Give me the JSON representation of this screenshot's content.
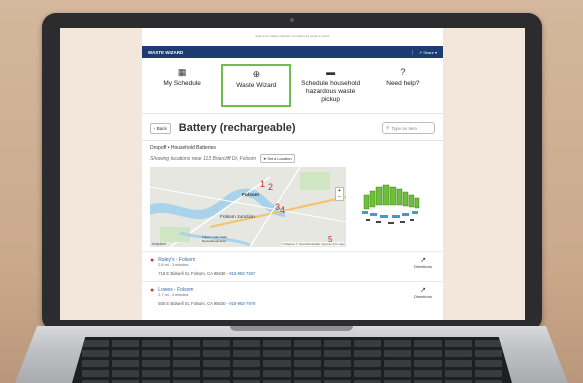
{
  "site": {
    "top_note": "Signup for waste collection reminders by email or phone",
    "brand": "WASTE WIZARD",
    "share_label": "Share"
  },
  "menu": [
    {
      "label": "My Schedule",
      "icon": "calendar-icon",
      "glyph": "▦"
    },
    {
      "label": "Waste Wizard",
      "icon": "magnifier-icon",
      "glyph": "⊕"
    },
    {
      "label": "Schedule household hazardous waste pickup",
      "icon": "truck-icon",
      "glyph": "▬"
    },
    {
      "label": "Need help?",
      "icon": "question-icon",
      "glyph": "?"
    }
  ],
  "item": {
    "back_label": "Back",
    "title": "Battery (rechargeable)",
    "search_placeholder": "Type an item"
  },
  "section": {
    "heading": "Dropoff • Household Batteries",
    "showing_text": "Showing locations near 113 Briarcliff Dr, Folsom",
    "get_location_label": "Set a Location"
  },
  "map": {
    "labels": [
      "Folsom",
      "Folsom Junction",
      "Folsom Lake State Recreational Area"
    ],
    "attribution": "© Mapbox © OpenStreetMap Improve this map",
    "logo": "mapbox",
    "zoom_in": "+",
    "zoom_out": "−",
    "markers": [
      "1",
      "2",
      "3",
      "4",
      "5"
    ]
  },
  "results": [
    {
      "name": "Raley's - Folsom",
      "distance": "2.8 mi - 3 minutes",
      "address": "715 E Bidwell St, Folsom, CA 95630 -",
      "phone": "916-983-7267",
      "action": "Directions"
    },
    {
      "name": "Lowes - Folsom",
      "distance": "2.7 mi - 4 minutes",
      "address": "500 E Bidwell St, Folsom, CA 95630 -",
      "phone": "916-983-7979",
      "action": "Directions"
    }
  ]
}
